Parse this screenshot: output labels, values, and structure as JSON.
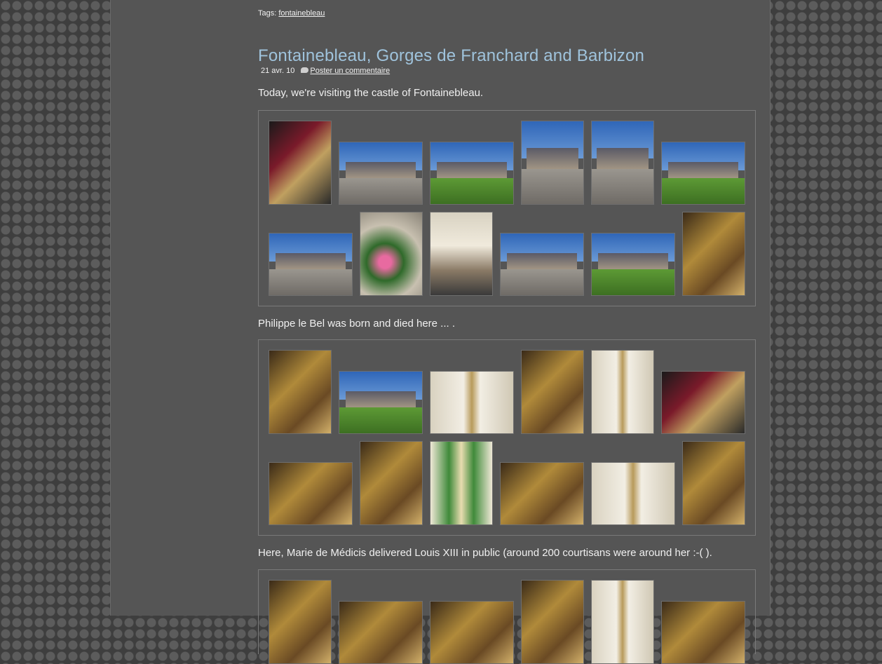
{
  "tags": {
    "label": "Tags:",
    "link": "fontainebleau"
  },
  "post": {
    "title": "Fontainebleau, Gorges de Franchard and Barbizon",
    "date": "21 avr. 10",
    "comment_link": "Poster un commentaire"
  },
  "paragraphs": [
    "Today, we're visiting the castle of Fontainebleau.",
    "Philippe le Bel was born and died here ... .",
    "Here, Marie de Médicis delivered Louis XIII in public (around 200 courtisans were around her :-( )."
  ],
  "colors": {
    "page_bg": "#555555",
    "title": "#9fc3dc",
    "sky": "#3f78c8",
    "lawn": "#4d8a2c",
    "gold": "#b08a3a"
  }
}
